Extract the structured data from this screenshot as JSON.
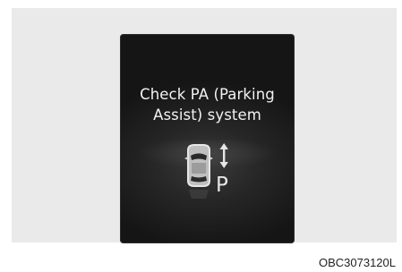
{
  "display": {
    "message_line1": "Check PA (Parking",
    "message_line2": "Assist) system",
    "icon": "parking-assist-car-icon",
    "icon_letter": "P"
  },
  "caption": "OBC3073120L",
  "colors": {
    "display_background": "#1e1e1e",
    "text": "#f2f2f2",
    "stage_background": "#eaeaea"
  }
}
